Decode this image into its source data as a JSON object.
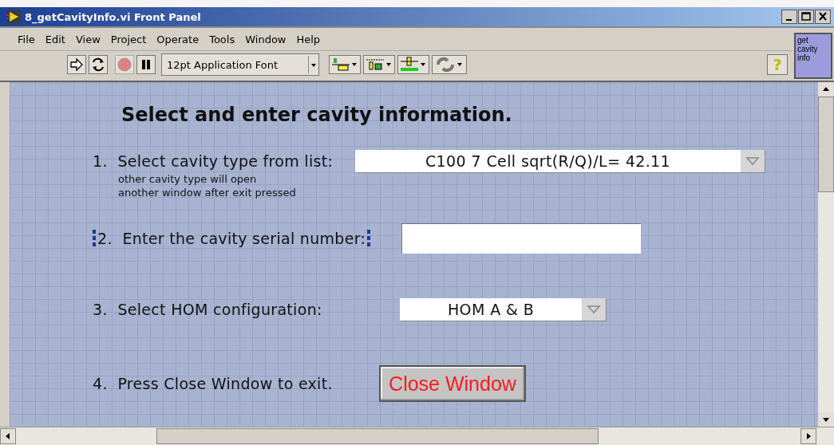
{
  "window": {
    "title": "8_getCavityInfo.vi Front Panel"
  },
  "menu": [
    "File",
    "Edit",
    "View",
    "Project",
    "Operate",
    "Tools",
    "Window",
    "Help"
  ],
  "toolbar": {
    "font": "12pt Application Font",
    "help": "?"
  },
  "vi_icon": {
    "text": "get cavity info"
  },
  "panel": {
    "heading": "Select and enter cavity information.",
    "steps": [
      {
        "kind": "dropdown",
        "number": "1.",
        "label": "Select cavity type from list:",
        "value": "C100 7 Cell sqrt(R/Q)/L= 42.11",
        "note": "other cavity type will open\nanother window after exit pressed",
        "selected": false
      },
      {
        "kind": "field",
        "number": "2.",
        "label": "Enter the cavity serial number:",
        "selected": true
      },
      {
        "kind": "dropdown",
        "number": "3.",
        "label": "Select HOM configuration:",
        "value": "HOM A & B",
        "selected": false
      },
      {
        "kind": "button",
        "number": "4.",
        "label": "Press Close Window to exit.",
        "value": "Close Window",
        "selected": false
      }
    ]
  }
}
